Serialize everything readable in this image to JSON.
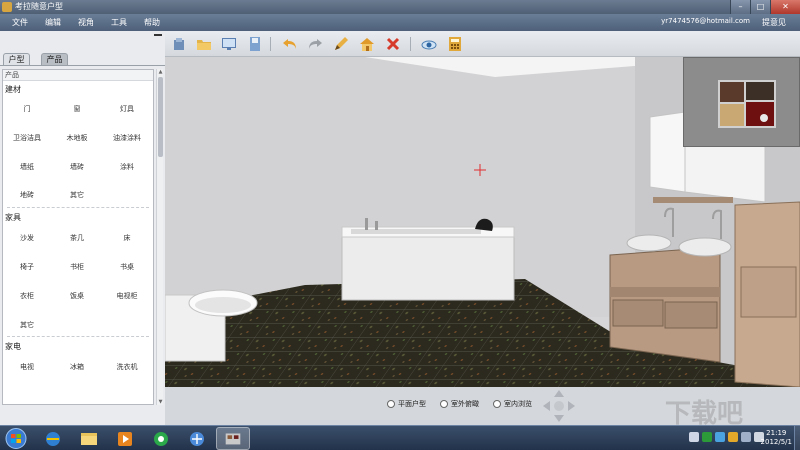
{
  "window": {
    "title": "考拉随意户型"
  },
  "menu": {
    "items": [
      "文件",
      "编辑",
      "视角",
      "工具",
      "帮助"
    ],
    "user": "yr7474576@hotmail.com",
    "feedback": "提意见"
  },
  "panel": {
    "tabs": [
      "户型",
      "产品"
    ],
    "active_tab": "产品",
    "list_header": "产品",
    "groups": [
      {
        "title": "建材",
        "items": [
          "门",
          "窗",
          "灯具",
          "卫浴洁具",
          "木地板",
          "油漆涂料",
          "墙纸",
          "墙砖",
          "涂料",
          "地砖",
          "其它"
        ]
      },
      {
        "title": "家具",
        "items": [
          "沙发",
          "茶几",
          "床",
          "椅子",
          "书柜",
          "书桌",
          "衣柜",
          "饭桌",
          "电视柜",
          "其它"
        ]
      },
      {
        "title": "家电",
        "items": [
          "电视",
          "冰箱",
          "洗衣机"
        ]
      }
    ]
  },
  "toolbar": {
    "icons": [
      "new-file-icon",
      "open-folder-icon",
      "display-icon",
      "save-icon",
      "undo-icon",
      "redo-icon",
      "pen-icon",
      "home-icon",
      "delete-icon",
      "view-eye-icon",
      "calculator-icon"
    ]
  },
  "view_modes": {
    "options": [
      "平面户型",
      "室外俯瞰",
      "室内浏览"
    ]
  },
  "watermark": "下载吧",
  "taskbar": {
    "time": "21:19",
    "date": "2012/5/1"
  }
}
